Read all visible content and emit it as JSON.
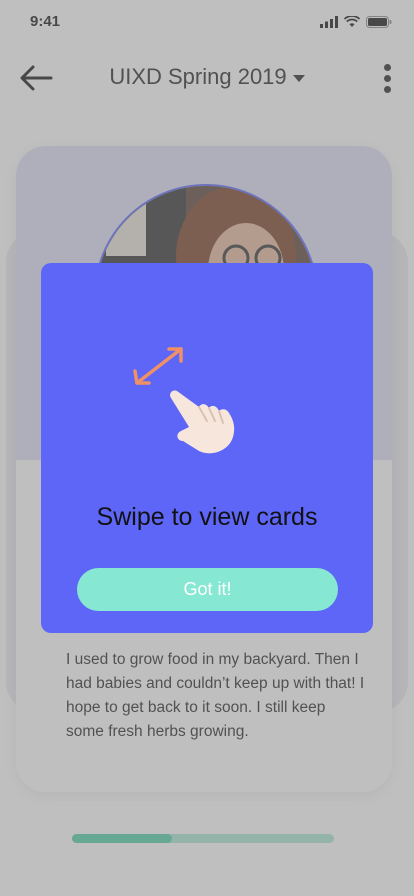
{
  "status_bar": {
    "time": "9:41",
    "icons": [
      "signal-icon",
      "wifi-icon",
      "battery-icon"
    ]
  },
  "header": {
    "back_icon": "back-arrow-icon",
    "title": "UIXD Spring 2019",
    "dropdown_icon": "caret-down-icon",
    "more_icon": "more-vertical-icon"
  },
  "card": {
    "text": "I used to grow food in my backyard. Then I had babies and couldn’t keep up with that! I hope to get back to it soon. I still keep some fresh herbs growing."
  },
  "progress": {
    "value_fraction": 0.38
  },
  "modal": {
    "title": "Swipe to view cards",
    "button_label": "Got it!",
    "icons": [
      "swipe-arrow-icon",
      "hand-swipe-icon"
    ]
  },
  "colors": {
    "modal_bg": "#5d66f6",
    "button_bg": "#86e7d2",
    "progress_track": "#a9e9d4",
    "progress_fill": "#4fd0a9",
    "swipe_arrow": "#f09068"
  }
}
